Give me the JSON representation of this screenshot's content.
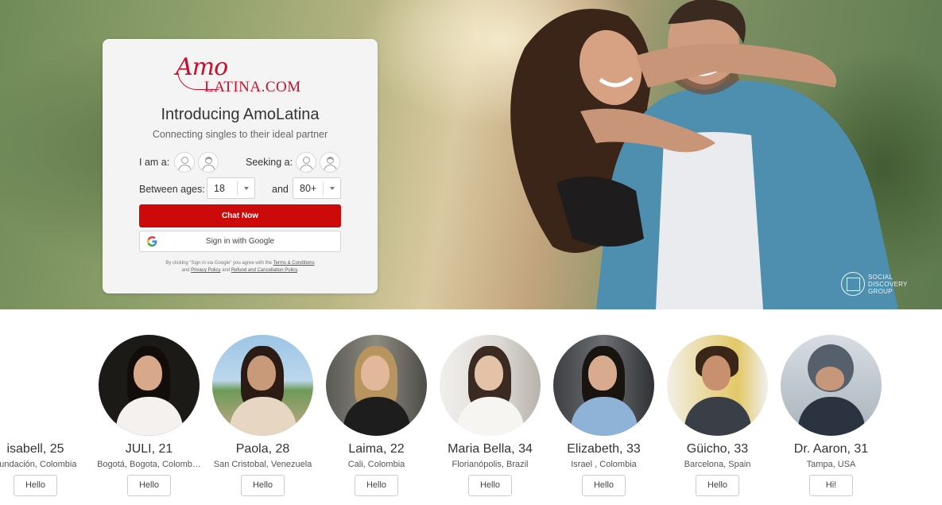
{
  "brand": {
    "logo_script": "Amo",
    "logo_word": "LATINA.COM",
    "watermark": "SOCIAL DISCOVERY GROUP"
  },
  "signup": {
    "title": "Introducing AmoLatina",
    "subtitle": "Connecting singles to their ideal partner",
    "i_am_label": "I am a:",
    "seeking_label": "Seeking a:",
    "between_label": "Between ages:",
    "and_label": "and",
    "age_min": "18",
    "age_max": "80+",
    "chat_now": "Chat Now",
    "google_signin": "Sign in with Google",
    "legal_pre": "By clicking \"Sign in via Google\" you agree with the",
    "terms": "Terms & Conditions",
    "and1": "and",
    "privacy": "Privacy Policy",
    "and2": "and",
    "refund": "Refund and Cancellation Policy",
    "legal_end": "."
  },
  "profiles": [
    {
      "name": "isabell, 25",
      "location": "Fundación, Colombia",
      "button": "Hello"
    },
    {
      "name": "JULI, 21",
      "location": "Bogotá, Bogota, Colomb…",
      "button": "Hello"
    },
    {
      "name": "Paola, 28",
      "location": "San Cristobal, Venezuela",
      "button": "Hello"
    },
    {
      "name": "Laima, 22",
      "location": "Cali, Colombia",
      "button": "Hello"
    },
    {
      "name": "Maria Bella, 34",
      "location": "Florianópolis, Brazil",
      "button": "Hello"
    },
    {
      "name": "Elizabeth, 33",
      "location": "Israel , Colombia",
      "button": "Hello"
    },
    {
      "name": "Güicho, 33",
      "location": "Barcelona, Spain",
      "button": "Hello"
    },
    {
      "name": "Dr. Aaron, 31",
      "location": "Tampa, USA",
      "button": "Hi!"
    }
  ],
  "colors": {
    "accent": "#cc0a0a",
    "brand": "#c8102e"
  }
}
